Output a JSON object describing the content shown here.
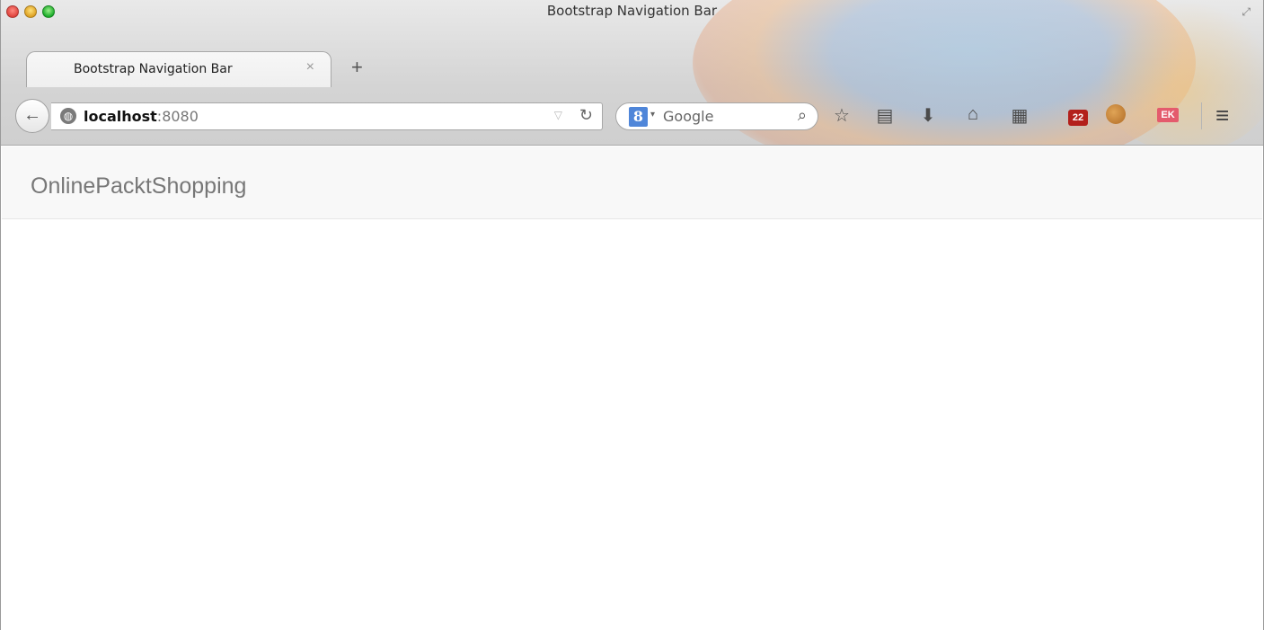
{
  "window": {
    "title": "Bootstrap Navigation Bar"
  },
  "tabs": [
    {
      "label": "Bootstrap Navigation Bar",
      "active": true
    }
  ],
  "urlbar": {
    "host": "localhost",
    "port": ":8080"
  },
  "search": {
    "engine": "Google",
    "placeholder": "Google",
    "engine_logo": "8"
  },
  "toolbar": {
    "icons": [
      "star-icon",
      "reading-list-icon",
      "download-icon",
      "home-icon",
      "tiles-icon",
      "calendar-badge-icon",
      "cookie-icon",
      "ek-extension-icon",
      "menu-icon"
    ],
    "calendar_badge": "22",
    "ek_label": "EK"
  },
  "page": {
    "navbar": {
      "brand": "OnlinePacktShopping",
      "background": "#f8f8f8",
      "brand_color": "#777777"
    }
  }
}
